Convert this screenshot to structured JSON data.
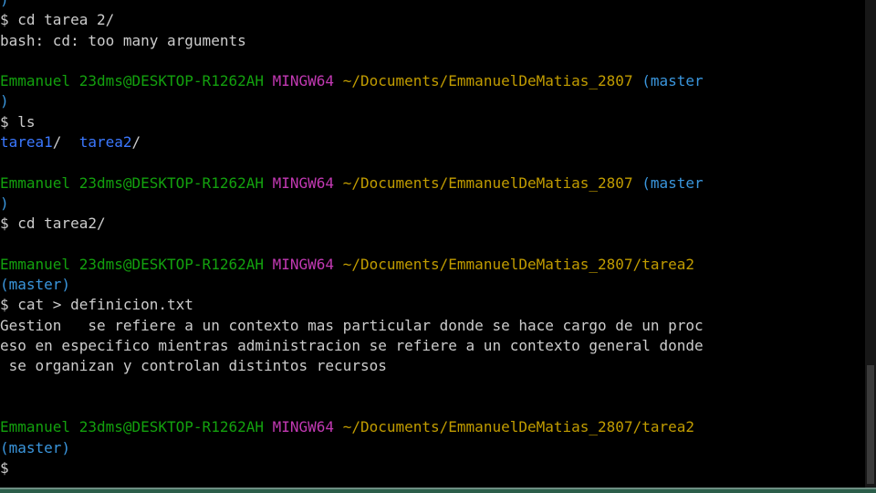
{
  "terminal": {
    "lines": [
      {
        "segments": [
          {
            "text": ")",
            "color": "cyan"
          }
        ]
      },
      {
        "segments": [
          {
            "text": "$ cd tarea 2/",
            "color": "white"
          }
        ]
      },
      {
        "segments": [
          {
            "text": "bash: cd: too many arguments",
            "color": "white"
          }
        ]
      },
      {
        "segments": []
      },
      {
        "segments": [
          {
            "text": "Emmanuel 23dms@DESKTOP-R1262AH ",
            "color": "green"
          },
          {
            "text": "MINGW64 ",
            "color": "magenta"
          },
          {
            "text": "~/Documents/EmmanuelDeMatias_2807 ",
            "color": "yellow"
          },
          {
            "text": "(master",
            "color": "cyan"
          }
        ]
      },
      {
        "segments": [
          {
            "text": ")",
            "color": "cyan"
          }
        ]
      },
      {
        "segments": [
          {
            "text": "$ ls",
            "color": "white"
          }
        ]
      },
      {
        "segments": [
          {
            "text": "tarea1",
            "color": "blue"
          },
          {
            "text": "/  ",
            "color": "white"
          },
          {
            "text": "tarea2",
            "color": "blue"
          },
          {
            "text": "/",
            "color": "white"
          }
        ]
      },
      {
        "segments": []
      },
      {
        "segments": [
          {
            "text": "Emmanuel 23dms@DESKTOP-R1262AH ",
            "color": "green"
          },
          {
            "text": "MINGW64 ",
            "color": "magenta"
          },
          {
            "text": "~/Documents/EmmanuelDeMatias_2807 ",
            "color": "yellow"
          },
          {
            "text": "(master",
            "color": "cyan"
          }
        ]
      },
      {
        "segments": [
          {
            "text": ")",
            "color": "cyan"
          }
        ]
      },
      {
        "segments": [
          {
            "text": "$ cd tarea2/",
            "color": "white"
          }
        ]
      },
      {
        "segments": []
      },
      {
        "segments": [
          {
            "text": "Emmanuel 23dms@DESKTOP-R1262AH ",
            "color": "green"
          },
          {
            "text": "MINGW64 ",
            "color": "magenta"
          },
          {
            "text": "~/Documents/EmmanuelDeMatias_2807/tarea2",
            "color": "yellow"
          }
        ]
      },
      {
        "segments": [
          {
            "text": "(master)",
            "color": "cyan"
          }
        ]
      },
      {
        "segments": [
          {
            "text": "$ cat > definicion.txt",
            "color": "white"
          }
        ]
      },
      {
        "segments": [
          {
            "text": "Gestion   se refiere a un contexto mas particular donde se hace cargo de un proc",
            "color": "white"
          }
        ]
      },
      {
        "segments": [
          {
            "text": "eso en especifico mientras administracion se refiere a un contexto general donde",
            "color": "white"
          }
        ]
      },
      {
        "segments": [
          {
            "text": " se organizan y controlan distintos recursos",
            "color": "white"
          }
        ]
      },
      {
        "segments": []
      },
      {
        "segments": []
      },
      {
        "segments": [
          {
            "text": "Emmanuel 23dms@DESKTOP-R1262AH ",
            "color": "green"
          },
          {
            "text": "MINGW64 ",
            "color": "magenta"
          },
          {
            "text": "~/Documents/EmmanuelDeMatias_2807/tarea2",
            "color": "yellow"
          }
        ]
      },
      {
        "segments": [
          {
            "text": "(master)",
            "color": "cyan"
          }
        ]
      },
      {
        "segments": [
          {
            "text": "$",
            "color": "white"
          }
        ]
      }
    ]
  }
}
